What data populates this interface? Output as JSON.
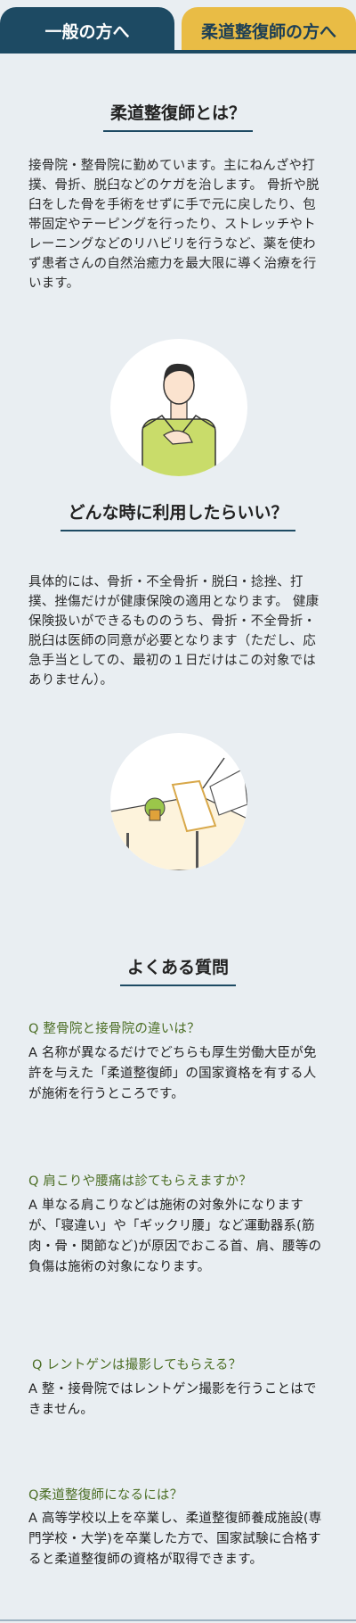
{
  "tabs": {
    "general": "一般の方へ",
    "judo": "柔道整復師の方へ"
  },
  "section1": {
    "title": "柔道整復師とは？",
    "body": "接骨院・整骨院に勤めています。主にねんざや打撲、骨折、脱臼などのケガを治します。 骨折や脱臼をした骨を手術をせずに手で元に戻したり、包帯固定やテーピングを行ったり、ストレッチやトレーニングなどのリハビリを行うなど、薬を使わず患者さんの自然治癒力を最大限に導く治療を行います。"
  },
  "section2": {
    "title": "どんな時に利用したらいい？",
    "body": "具体的には、骨折・不全骨折・脱臼・捻挫、打撲、挫傷だけが健康保険の適用となります。 健康保険扱いができるもののうち、骨折・不全骨折・脱臼は医師の同意が必要となります（ただし、応急手当としての、最初の１日だけはこの対象ではありません）。"
  },
  "faq": {
    "title": "よくある質問",
    "items": [
      {
        "q": "Q 整骨院と接骨院の違いは？",
        "a": "A 名称が異なるだけでどちらも厚生労働大臣が免許を与えた「柔道整復師」の国家資格を有する人が施術を行うところです。"
      },
      {
        "q": "Q 肩こりや腰痛は診てもらえますか？",
        "a": "A 単なる肩こりなどは施術の対象外になりますが、「寝違い」や「ギックリ腰」など運動器系(筋肉・骨・関節など)が原因でおこる首、肩、腰等の負傷は施術の対象になります。"
      },
      {
        "q": "Q レントゲンは撮影してもらえる？",
        "a": "A 整・接骨院ではレントゲン撮影を行うことはできません。"
      },
      {
        "q": "Q柔道整復師になるには？",
        "a": "A 高等学校以上を卒業し、柔道整復師養成施設(専門学校・大学)を卒業した方で、国家試験に合格すると柔道整復師の資格が取得できます。"
      }
    ]
  },
  "colors": {
    "navy": "#1d4a63",
    "gold": "#e9bc45",
    "background": "#e9eef2",
    "question_green": "#4c6e25"
  }
}
